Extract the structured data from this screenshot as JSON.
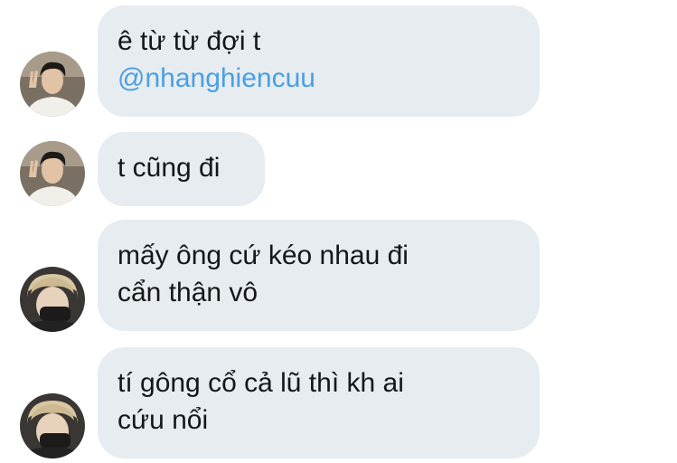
{
  "messages": [
    {
      "sender_avatar": "avatar-man-peace-sign",
      "lines": [
        "ê từ từ đợi t",
        "@nhanghiencuu"
      ]
    },
    {
      "sender_avatar": "avatar-man-peace-sign",
      "lines": [
        "t cũng đi"
      ]
    },
    {
      "sender_avatar": "avatar-blonde-hair-hand-over-face",
      "lines": [
        "mấy ông cứ kéo nhau đi",
        "cẩn thận vô"
      ]
    },
    {
      "sender_avatar": "avatar-blonde-hair-hand-over-face",
      "lines": [
        "tí gông cổ cả lũ thì kh ai",
        "cứu nổi"
      ]
    }
  ],
  "colors": {
    "bubble": "#e6ecf0",
    "text": "#14171a",
    "mention": "#4a9fe6",
    "background": "#ffffff"
  }
}
